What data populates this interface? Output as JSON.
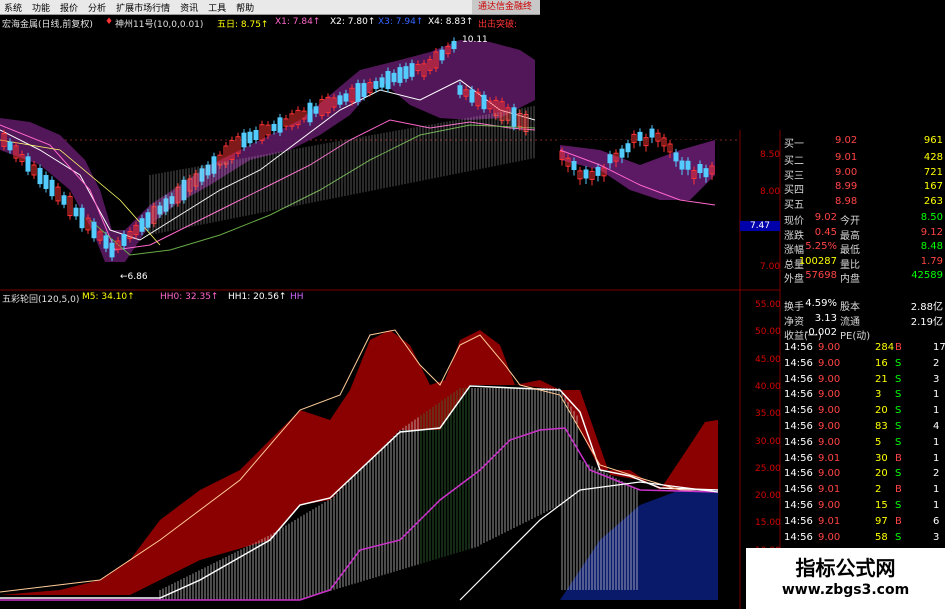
{
  "menu": [
    "系统",
    "功能",
    "报价",
    "分析",
    "扩展市场行情",
    "资讯",
    "工具",
    "帮助"
  ],
  "menu_right": "通达信金融终",
  "stock": {
    "name": "宏海金属(日线,前复权)",
    "indicator": "神州11号(10,0,0.01)",
    "vals": [
      {
        "label": "五日: 8.75↑",
        "color": "#ffff00"
      },
      {
        "label": "X1: 7.84↑",
        "color": "#ff66cc"
      },
      {
        "label": "X2: 7.80↑",
        "color": "#ffffff"
      },
      {
        "label": "X3: 7.94↑",
        "color": "#3366ff"
      },
      {
        "label": "X4: 8.83↑",
        "color": "#ffffff"
      },
      {
        "label": "出击突破:",
        "color": "#ff3333"
      }
    ],
    "high_label": "10.11",
    "low_label": "6.86"
  },
  "indicator_bar": {
    "name": "五彩轮回(120,5,0)",
    "m5": "M5: 34.10↑",
    "hh0": "HH0: 32.35↑",
    "hh1": "HH1: 20.56↑",
    "hh2": "HH"
  },
  "price_axis": [
    "8.50",
    "8.00",
    "7.47",
    "7.00"
  ],
  "ind_axis": [
    "55.00",
    "50.00",
    "45.00",
    "40.00",
    "35.00",
    "30.00",
    "25.00",
    "20.00",
    "15.00",
    "10.00",
    "5.00"
  ],
  "orderbook": [
    {
      "l": "买二",
      "p": "9.01",
      "v": "428"
    },
    {
      "l": "买三",
      "p": "9.00",
      "v": "721"
    },
    {
      "l": "买四",
      "p": "8.99",
      "v": "167"
    },
    {
      "l": "买五",
      "p": "8.98",
      "v": "263"
    }
  ],
  "orderbook_top": {
    "l": "买一",
    "p": "9.02",
    "v": "961"
  },
  "stats": [
    {
      "a": "现价",
      "av": "9.02",
      "b": "今开",
      "bv": "8.50"
    },
    {
      "a": "涨跌",
      "av": "0.45",
      "b": "最高",
      "bv": "9.12"
    },
    {
      "a": "涨幅",
      "av": "5.25%",
      "b": "最低",
      "bv": "8.48"
    },
    {
      "a": "总量",
      "av": "100287",
      "b": "量比",
      "bv": "1.79"
    },
    {
      "a": "外盘",
      "av": "57698",
      "b": "内盘",
      "bv": "42589"
    },
    {
      "a": "换手",
      "av": "4.59%",
      "b": "股本",
      "bv": "2.88亿"
    },
    {
      "a": "净资",
      "av": "3.13",
      "b": "流通",
      "bv": "2.19亿"
    },
    {
      "a": "收益(一)",
      "av": "-0.002",
      "b": "PE(动)",
      "bv": ""
    }
  ],
  "ticks": [
    {
      "t": "14:56",
      "p": "9.00",
      "v": "284",
      "s": "B",
      "n": "17"
    },
    {
      "t": "14:56",
      "p": "9.00",
      "v": "16",
      "s": "S",
      "n": "2"
    },
    {
      "t": "14:56",
      "p": "9.00",
      "v": "21",
      "s": "S",
      "n": "3"
    },
    {
      "t": "14:56",
      "p": "9.00",
      "v": "3",
      "s": "S",
      "n": "1"
    },
    {
      "t": "14:56",
      "p": "9.00",
      "v": "20",
      "s": "S",
      "n": "1"
    },
    {
      "t": "14:56",
      "p": "9.00",
      "v": "83",
      "s": "S",
      "n": "4"
    },
    {
      "t": "14:56",
      "p": "9.00",
      "v": "5",
      "s": "S",
      "n": "1"
    },
    {
      "t": "14:56",
      "p": "9.01",
      "v": "30",
      "s": "B",
      "n": "1"
    },
    {
      "t": "14:56",
      "p": "9.00",
      "v": "20",
      "s": "S",
      "n": "2"
    },
    {
      "t": "14:56",
      "p": "9.01",
      "v": "2",
      "s": "B",
      "n": "1"
    },
    {
      "t": "14:56",
      "p": "9.00",
      "v": "15",
      "s": "S",
      "n": "1"
    },
    {
      "t": "14:56",
      "p": "9.01",
      "v": "97",
      "s": "B",
      "n": "6"
    },
    {
      "t": "14:56",
      "p": "9.00",
      "v": "58",
      "s": "S",
      "n": "3"
    },
    {
      "t": "14:56",
      "p": "9.01",
      "v": "10",
      "s": "B",
      "n": "1"
    },
    {
      "t": "14:56",
      "p": "9.00",
      "v": "20",
      "s": "S",
      "n": "1"
    }
  ],
  "watermark": {
    "title": "指标公式网",
    "url": "www.zbgs3.com"
  }
}
